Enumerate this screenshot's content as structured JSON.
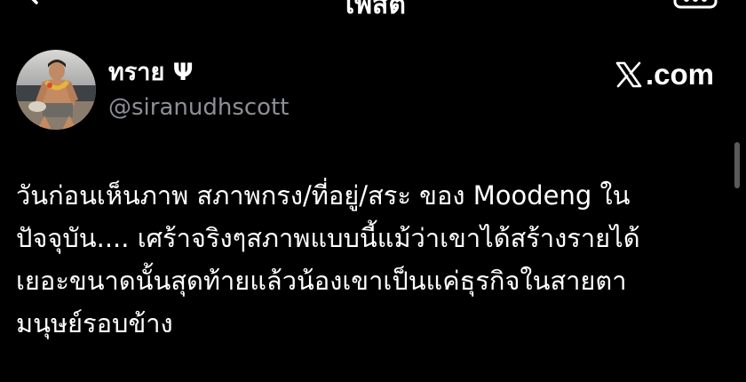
{
  "header": {
    "title": "โพสต์",
    "back_icon": "arrow-left-icon",
    "more_icon": "more-icon"
  },
  "author": {
    "display_name": "ทราย Ψ",
    "handle": "@siranudhscott",
    "avatar": "profile-photo"
  },
  "source": {
    "logo": "x-logo-icon",
    "text": ".com"
  },
  "tweet": {
    "lines": [
      "วันก่อนเห็นภาพ สภาพกรง/ที่อยู่/สระ ของ Moodeng ใน",
      "ปัจจุบัน.... เศร้าจริงๆสภาพแบบนี้แม้ว่าเขาได้สร้างรายได้",
      "เยอะขนาดนั้นสุดท้ายแล้วน้องเขาเป็นแค่ธุรกิจในสายตา",
      "มนุษย์รอบข้าง"
    ]
  },
  "colors": {
    "background": "#000000",
    "text": "#ffffff",
    "secondary_text": "#8b9096"
  }
}
